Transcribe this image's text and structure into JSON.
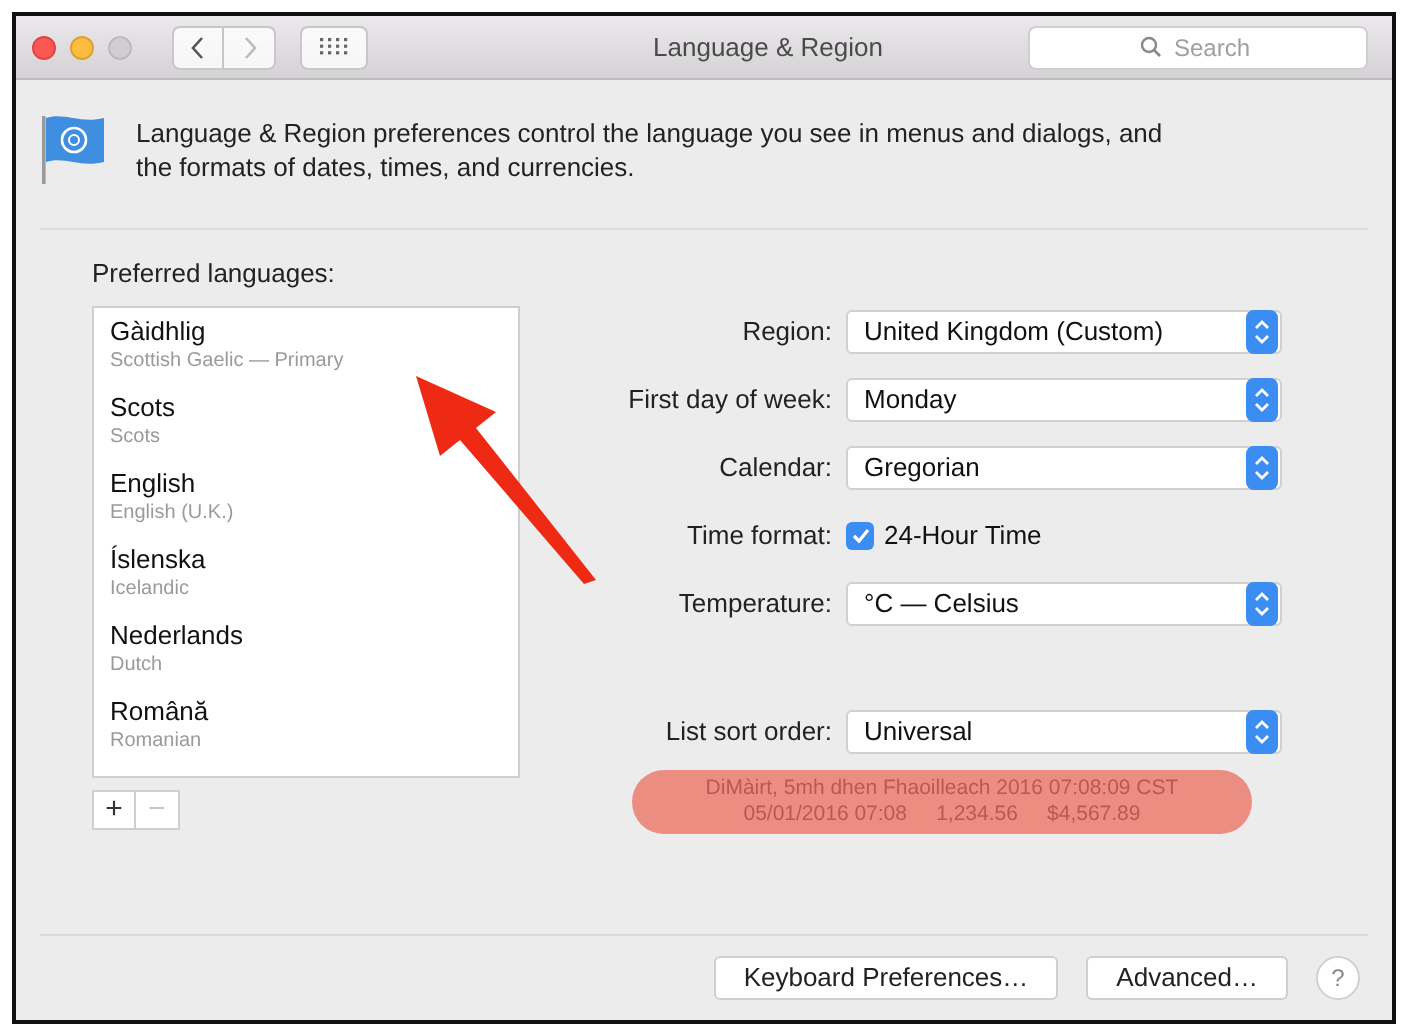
{
  "window": {
    "title": "Language & Region"
  },
  "search": {
    "placeholder": "Search"
  },
  "description": "Language & Region preferences control the language you see in menus and dialogs, and the formats of dates, times, and currencies.",
  "preferred_languages": {
    "label": "Preferred languages:",
    "items": [
      {
        "name": "Gàidhlig",
        "subtitle": "Scottish Gaelic — Primary"
      },
      {
        "name": "Scots",
        "subtitle": "Scots"
      },
      {
        "name": "English",
        "subtitle": "English (U.K.)"
      },
      {
        "name": "Íslenska",
        "subtitle": "Icelandic"
      },
      {
        "name": "Nederlands",
        "subtitle": "Dutch"
      },
      {
        "name": "Română",
        "subtitle": "Romanian"
      }
    ],
    "add": {
      "label": "+",
      "disabled": false
    },
    "remove": {
      "label": "−",
      "disabled": true
    }
  },
  "settings": [
    {
      "kind": "popup",
      "label": "Region:",
      "value": "United Kingdom (Custom)"
    },
    {
      "kind": "popup",
      "label": "First day of week:",
      "value": "Monday"
    },
    {
      "kind": "popup",
      "label": "Calendar:",
      "value": "Gregorian"
    },
    {
      "kind": "checkbox",
      "label": "Time format:",
      "value": "24-Hour Time",
      "checked": true
    },
    {
      "kind": "popup",
      "label": "Temperature:",
      "value": "°C — Celsius"
    },
    {
      "kind": "spacer"
    },
    {
      "kind": "popup",
      "label": "List sort order:",
      "value": "Universal"
    }
  ],
  "sample": [
    "DiMàirt, 5mh dhen Fhaoilleach 2016 07:08:09 CST",
    "05/01/2016 07:08     1,234.56     $4,567.89"
  ],
  "buttons": [
    "Keyboard Preferences…",
    "Advanced…"
  ],
  "help": "?"
}
